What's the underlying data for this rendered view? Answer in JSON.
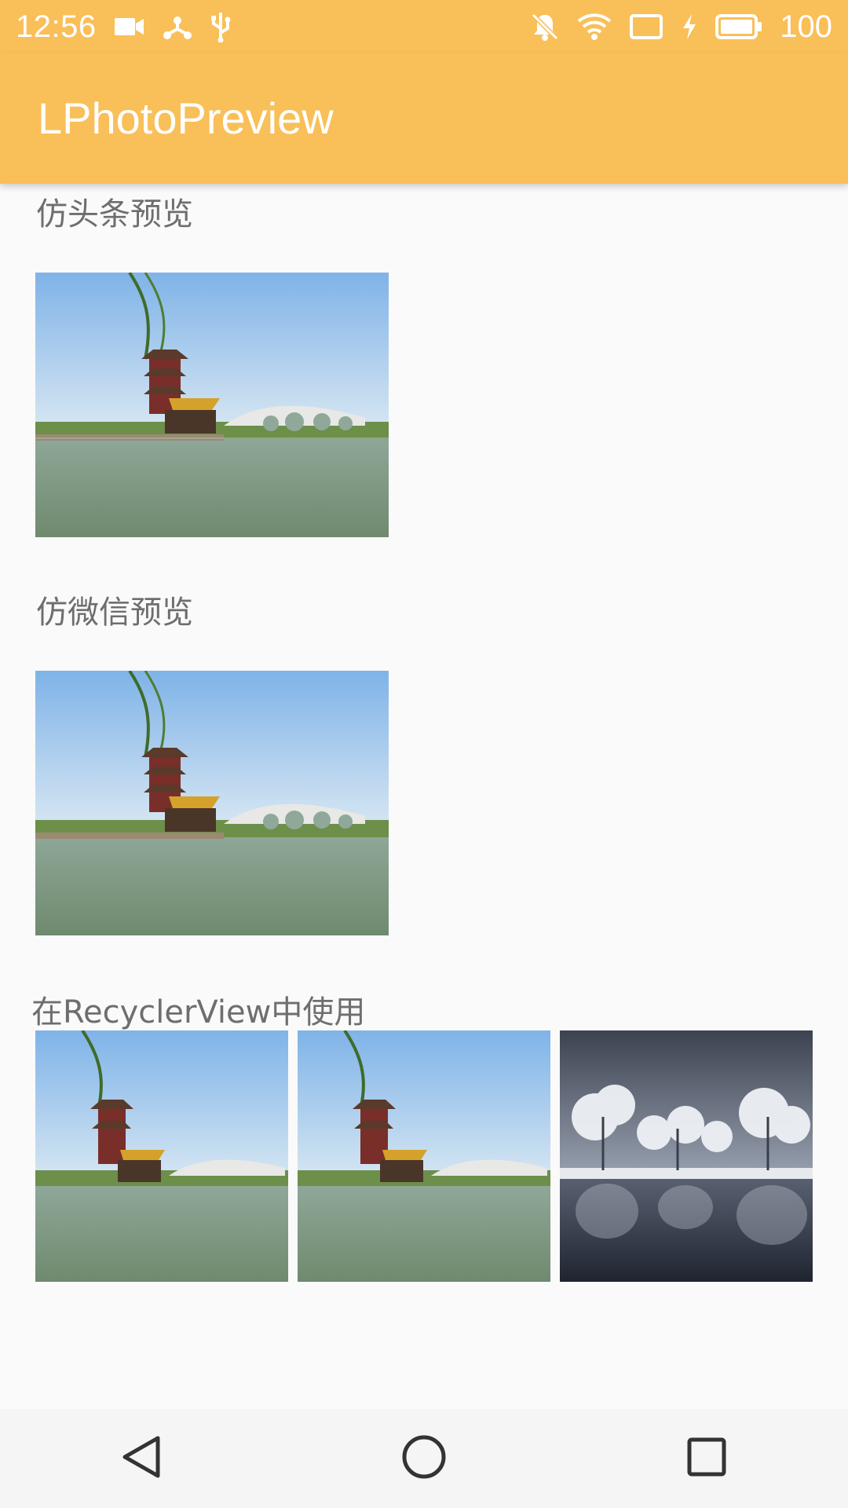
{
  "status_bar": {
    "time": "12:56",
    "battery_level": "100",
    "icons": [
      "video-camera-icon",
      "usb-tether-icon",
      "usb-debug-icon",
      "notifications-muted-icon",
      "wifi-icon",
      "cast-icon",
      "charging-bolt-icon",
      "battery-icon"
    ]
  },
  "app_bar": {
    "title": "LPhotoPreview",
    "color": "#f9bf58"
  },
  "sections": [
    {
      "label": "仿头条预览",
      "images": [
        "pagoda-bridge-photo"
      ]
    },
    {
      "label": "仿微信预览",
      "images": [
        "pagoda-bridge-photo"
      ]
    },
    {
      "label": "在RecyclerView中使用",
      "images": [
        "pagoda-bridge-photo",
        "pagoda-bridge-photo",
        "snowy-trees-lake-photo"
      ]
    }
  ],
  "nav_bar": {
    "buttons": [
      "back-icon",
      "home-icon",
      "recents-icon"
    ]
  }
}
